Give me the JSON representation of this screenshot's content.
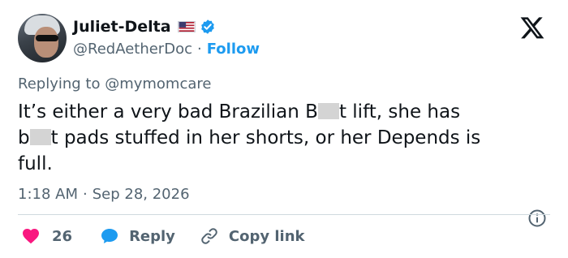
{
  "author": {
    "display_name": "Juliet-Delta",
    "handle": "@RedAetherDoc",
    "separator": "·",
    "follow_label": "Follow"
  },
  "reply": {
    "prefix": "Replying to ",
    "mention": "@mymomcare"
  },
  "tweet": {
    "line1_a": "It’s either a very bad Brazilian B",
    "line1_b": "t lift, she has",
    "line2_a": "b",
    "line2_b": "t pads stuffed in her shorts, or her Depends is",
    "line3": "full."
  },
  "meta": {
    "time": "1:18 AM",
    "separator": "·",
    "date": "Sep 28, 2026"
  },
  "actions": {
    "like_count": "26",
    "reply_label": "Reply",
    "copy_label": "Copy link"
  },
  "colors": {
    "accent": "#1d9bf0",
    "like": "#f91880",
    "text": "#0f1419",
    "muted": "#536471"
  },
  "icons": [
    "flag-usa-icon",
    "verified-badge-icon",
    "x-logo-icon",
    "info-icon",
    "heart-icon",
    "reply-bubble-icon",
    "link-icon"
  ]
}
